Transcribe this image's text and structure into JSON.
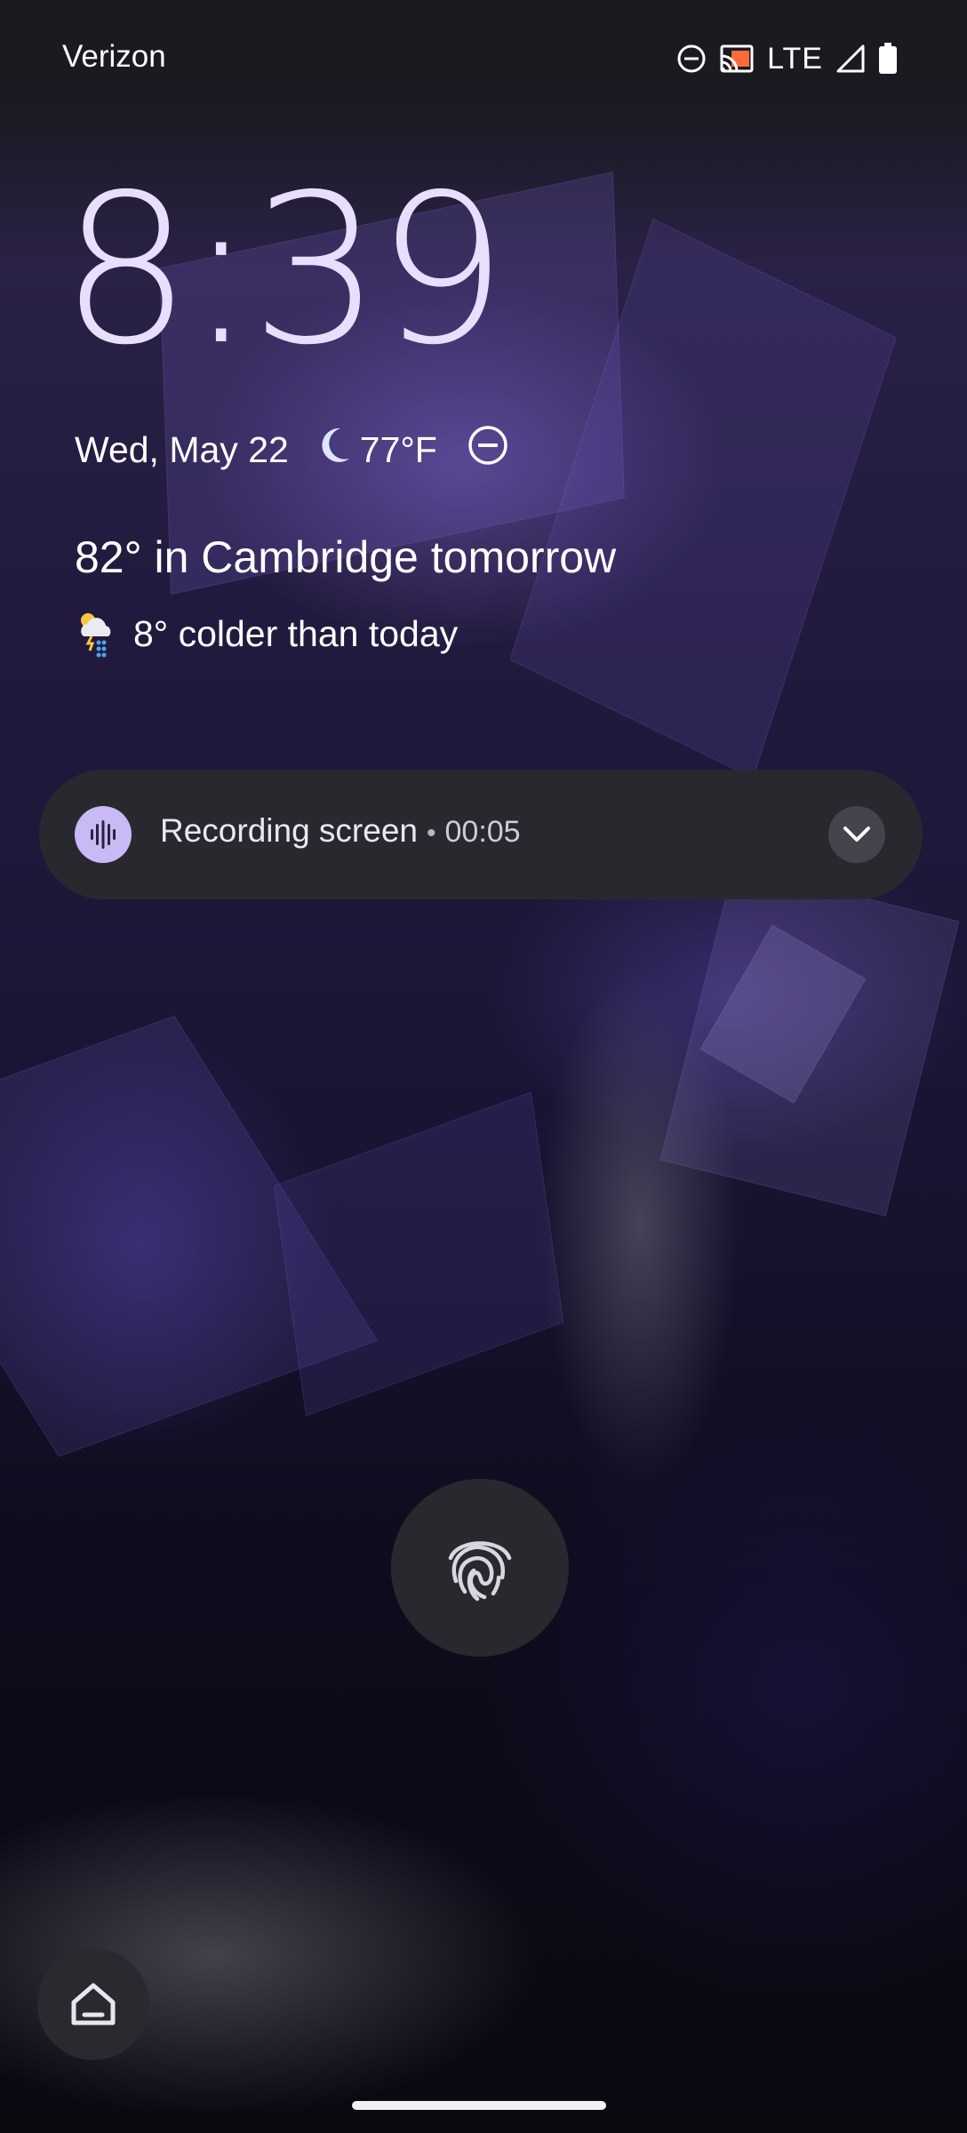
{
  "status_bar": {
    "carrier": "Verizon",
    "network_type": "LTE",
    "icons": [
      "do-not-disturb-icon",
      "cast-icon",
      "signal-icon",
      "battery-icon"
    ]
  },
  "lockscreen": {
    "time": "8:39",
    "date": "Wed, May 22",
    "current_temp": "77°F",
    "weather_condition_icon": "moon-icon",
    "dnd_icon": "do-not-disturb-icon",
    "forecast": "82° in Cambridge tomorrow",
    "forecast_detail": "8° colder than today",
    "forecast_icon": "thunderstorm-rain-icon"
  },
  "notification": {
    "title": "Recording screen",
    "separator": "•",
    "elapsed": "00:05",
    "app_icon": "sound-wave-icon",
    "expand_icon": "chevron-down-icon"
  },
  "shortcuts": {
    "unlock_icon": "fingerprint-icon",
    "home_icon": "home-icon"
  },
  "colors": {
    "clock": "#e7dffd",
    "chip_background": "#2a282f",
    "recording_accent": "#c9b9f5"
  }
}
